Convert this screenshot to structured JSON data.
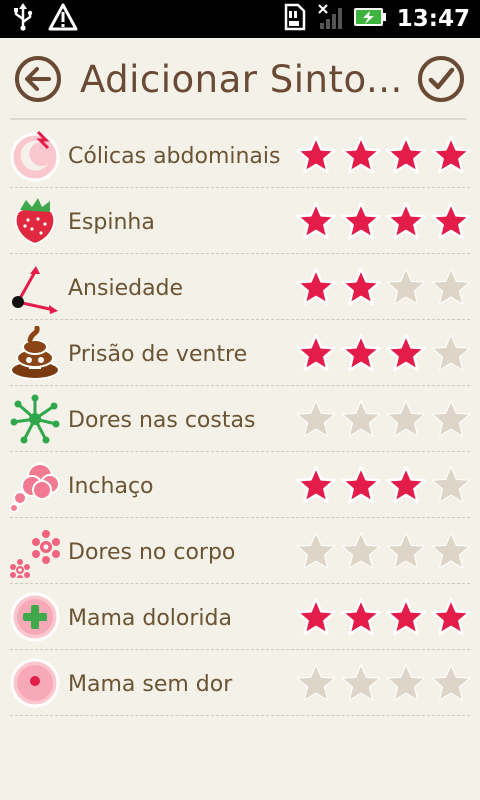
{
  "status_bar": {
    "time": "13:47",
    "icons": [
      "usb-icon",
      "warning-icon",
      "sd-card-icon",
      "signal-icon",
      "battery-charging-icon"
    ]
  },
  "header": {
    "title": "Adicionar Sinto...",
    "back_icon": "back-arrow-icon",
    "confirm_icon": "checkmark-icon"
  },
  "colors": {
    "accent_brown": "#6a4a35",
    "label_brown": "#6b5433",
    "star_filled": "#e31c4a",
    "star_empty": "#ddd6c8",
    "background": "#f4f1e8"
  },
  "max_rating": 4,
  "symptoms": [
    {
      "label": "Cólicas abdominais",
      "icon": "cramps-moon-icon",
      "rating": 4
    },
    {
      "label": "Espinha",
      "icon": "strawberry-icon",
      "rating": 4
    },
    {
      "label": "Ansiedade",
      "icon": "anxiety-arrows-icon",
      "rating": 2
    },
    {
      "label": "Prisão de ventre",
      "icon": "poop-icon",
      "rating": 3
    },
    {
      "label": "Dores nas costas",
      "icon": "back-pain-splat-icon",
      "rating": 0
    },
    {
      "label": "Inchaço",
      "icon": "bloating-cloud-icon",
      "rating": 3
    },
    {
      "label": "Dores no corpo",
      "icon": "body-ache-flowers-icon",
      "rating": 0
    },
    {
      "label": "Mama dolorida",
      "icon": "sore-breast-plus-icon",
      "rating": 4
    },
    {
      "label": "Mama sem dor",
      "icon": "breast-no-pain-icon",
      "rating": 0
    }
  ]
}
